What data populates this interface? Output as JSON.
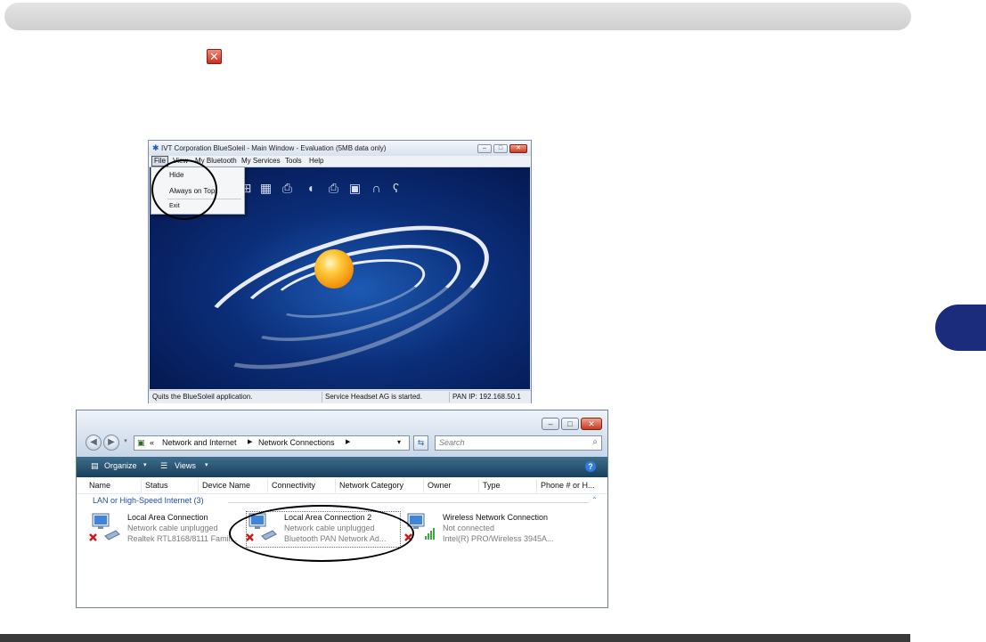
{
  "decor": {
    "close_glyph": "✕"
  },
  "bluesoleil": {
    "title": "IVT Corporation BlueSoleil - Main Window - Evaluation (5MB data only)",
    "menu": [
      "File",
      "View",
      "My Bluetooth",
      "My Services",
      "Tools",
      "Help"
    ],
    "file_menu": [
      "Hide",
      "Always on Top",
      "Exit"
    ],
    "service_icons": [
      "network-icon",
      "serial-port-icon",
      "printer-icon",
      "mouse-icon",
      "fax-icon",
      "camera-icon",
      "headset-icon",
      "headphone-icon"
    ],
    "status": {
      "left": "Quits the BlueSoleil application.",
      "middle": "Service Headset AG is started.",
      "right": "PAN IP: 192.168.50.1"
    }
  },
  "netconn": {
    "breadcrumb": [
      "«",
      "Network and Internet",
      "Network Connections"
    ],
    "search_placeholder": "Search",
    "toolbar": {
      "organize": "Organize",
      "views": "Views"
    },
    "columns": [
      "Name",
      "Status",
      "Device Name",
      "Connectivity",
      "Network Category",
      "Owner",
      "Type",
      "Phone # or H..."
    ],
    "group": "LAN or High-Speed Internet (3)",
    "connections": [
      {
        "name": "Local Area Connection",
        "status": "Network cable unplugged",
        "device": "Realtek RTL8168/8111 Famil..."
      },
      {
        "name": "Local Area Connection 2",
        "status": "Network cable unplugged",
        "device": "Bluetooth PAN Network Ad..."
      },
      {
        "name": "Wireless Network Connection",
        "status": "Not connected",
        "device": "Intel(R) PRO/Wireless 3945A..."
      }
    ]
  }
}
